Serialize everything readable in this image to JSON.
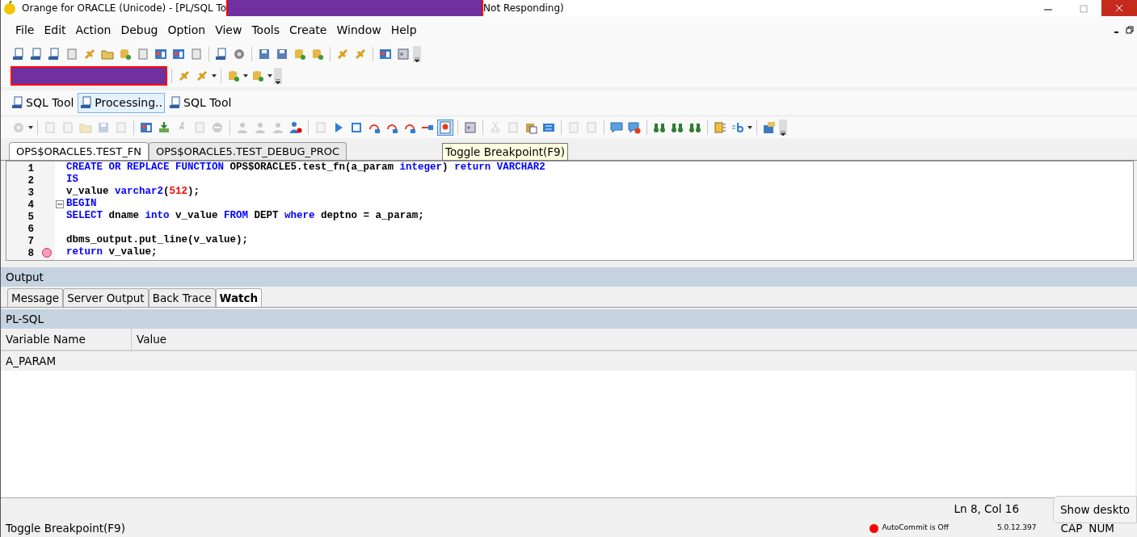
{
  "window": {
    "title_start": "Orange for ORACLE (Unicode) - [PL/SQL To",
    "title_end": "Not Responding)"
  },
  "menu": [
    "File",
    "Edit",
    "Action",
    "Debug",
    "Option",
    "View",
    "Tools",
    "Create",
    "Window",
    "Help"
  ],
  "tool_tabs": [
    {
      "label": "SQL Tool",
      "selected": false
    },
    {
      "label": "Processing..",
      "selected": true
    },
    {
      "label": "SQL Tool",
      "selected": false
    }
  ],
  "debug_toolbar": [
    {
      "kind": "gear",
      "disabled": true,
      "pressed": false
    },
    {
      "kind": "sep"
    },
    {
      "kind": "doc",
      "disabled": true,
      "pressed": false
    },
    {
      "kind": "doc",
      "disabled": true,
      "pressed": false
    },
    {
      "kind": "folder",
      "disabled": true,
      "pressed": false
    },
    {
      "kind": "save",
      "disabled": true,
      "pressed": false
    },
    {
      "kind": "doc",
      "disabled": true,
      "pressed": false
    },
    {
      "kind": "sep"
    },
    {
      "kind": "window",
      "disabled": false,
      "pressed": false
    },
    {
      "kind": "download",
      "disabled": false,
      "pressed": false
    },
    {
      "kind": "figure",
      "disabled": true,
      "pressed": false
    },
    {
      "kind": "doc",
      "disabled": true,
      "pressed": false
    },
    {
      "kind": "stopcircle",
      "disabled": true,
      "pressed": false
    },
    {
      "kind": "sep"
    },
    {
      "kind": "person",
      "disabled": true,
      "pressed": false
    },
    {
      "kind": "person",
      "disabled": true,
      "pressed": false
    },
    {
      "kind": "person",
      "disabled": true,
      "pressed": false
    },
    {
      "kind": "check",
      "disabled": false,
      "pressed": false
    },
    {
      "kind": "sep"
    },
    {
      "kind": "doc",
      "disabled": true,
      "pressed": false
    },
    {
      "kind": "play",
      "disabled": false,
      "pressed": false
    },
    {
      "kind": "stop",
      "disabled": false,
      "pressed": false
    },
    {
      "kind": "step",
      "disabled": false,
      "pressed": false
    },
    {
      "kind": "step",
      "disabled": false,
      "pressed": false
    },
    {
      "kind": "step",
      "disabled": false,
      "pressed": false
    },
    {
      "kind": "runto",
      "disabled": false,
      "pressed": false
    },
    {
      "kind": "breakpoint",
      "disabled": false,
      "pressed": true
    },
    {
      "kind": "sep"
    },
    {
      "kind": "list",
      "disabled": false,
      "pressed": false
    },
    {
      "kind": "sep"
    },
    {
      "kind": "scissors",
      "disabled": true,
      "pressed": false
    },
    {
      "kind": "doc",
      "disabled": true,
      "pressed": false
    },
    {
      "kind": "paste",
      "disabled": false,
      "pressed": false
    },
    {
      "kind": "all",
      "disabled": false,
      "pressed": false
    },
    {
      "kind": "sep"
    },
    {
      "kind": "doc",
      "disabled": true,
      "pressed": false
    },
    {
      "kind": "doc",
      "disabled": true,
      "pressed": false
    },
    {
      "kind": "sep"
    },
    {
      "kind": "chat",
      "disabled": false,
      "pressed": false
    },
    {
      "kind": "chatx",
      "disabled": false,
      "pressed": false
    },
    {
      "kind": "sep"
    },
    {
      "kind": "binoculars",
      "disabled": false,
      "pressed": false
    },
    {
      "kind": "binoculars",
      "disabled": false,
      "pressed": false
    },
    {
      "kind": "binoculars",
      "disabled": false,
      "pressed": false
    },
    {
      "kind": "sep"
    },
    {
      "kind": "panel",
      "disabled": false,
      "pressed": false
    },
    {
      "kind": "assign",
      "disabled": false,
      "pressed": false
    },
    {
      "kind": "sep"
    },
    {
      "kind": "props",
      "disabled": false,
      "pressed": false
    }
  ],
  "doc_tabs": [
    {
      "label": "OPS$ORACLE5.TEST_FN",
      "selected": true
    },
    {
      "label": "OPS$ORACLE5.TEST_DEBUG_PROC",
      "selected": false
    }
  ],
  "tooltip": "Toggle Breakpoint(F9)",
  "editor": {
    "lines": [
      {
        "number": "1",
        "breakpoint": false,
        "fold_start": false,
        "tokens": [
          {
            "kind": "kw",
            "text": "CREATE OR REPLACE FUNCTION"
          },
          {
            "kind": "plain",
            "text": " OPS$ORACLE5.test_fn(a_param "
          },
          {
            "kind": "kw",
            "text": "integer"
          },
          {
            "kind": "plain",
            "text": ") "
          },
          {
            "kind": "kw",
            "text": "return VARCHAR2"
          }
        ]
      },
      {
        "number": "2",
        "breakpoint": false,
        "fold_start": false,
        "tokens": [
          {
            "kind": "kw",
            "text": "IS"
          }
        ]
      },
      {
        "number": "3",
        "breakpoint": false,
        "fold_start": false,
        "tokens": [
          {
            "kind": "plain",
            "text": "v_value "
          },
          {
            "kind": "kw",
            "text": "varchar2"
          },
          {
            "kind": "plain",
            "text": "("
          },
          {
            "kind": "num",
            "text": "512"
          },
          {
            "kind": "plain",
            "text": ");"
          }
        ]
      },
      {
        "number": "4",
        "breakpoint": false,
        "fold_start": true,
        "tokens": [
          {
            "kind": "kw",
            "text": "BEGIN"
          }
        ]
      },
      {
        "number": "5",
        "breakpoint": false,
        "fold_start": false,
        "tokens": [
          {
            "kind": "kw",
            "text": "SELECT"
          },
          {
            "kind": "plain",
            "text": " dname "
          },
          {
            "kind": "kw",
            "text": "into"
          },
          {
            "kind": "plain",
            "text": " v_value "
          },
          {
            "kind": "kw",
            "text": "FROM"
          },
          {
            "kind": "plain",
            "text": " DEPT "
          },
          {
            "kind": "kw",
            "text": "where"
          },
          {
            "kind": "plain",
            "text": " deptno = a_param;"
          }
        ]
      },
      {
        "number": "6",
        "breakpoint": false,
        "fold_start": false
      },
      {
        "number": "7",
        "breakpoint": false,
        "fold_start": false,
        "tokens": [
          {
            "kind": "plain",
            "text": "dbms_output.put_line(v_value);"
          }
        ]
      },
      {
        "number": "8",
        "breakpoint": true,
        "fold_start": false,
        "tokens": [
          {
            "kind": "kw",
            "text": "return"
          },
          {
            "kind": "plain",
            "text": " v_value;"
          }
        ]
      }
    ]
  },
  "output": {
    "title": "Output",
    "tabs": [
      {
        "label": "Message",
        "selected": false
      },
      {
        "label": "Server Output",
        "selected": false
      },
      {
        "label": "Back Trace",
        "selected": false
      },
      {
        "label": "Watch",
        "selected": true
      }
    ],
    "section": "PL-SQL",
    "columns": [
      "Variable Name",
      "Value"
    ],
    "rows": [
      [
        "A_PARAM"
      ]
    ]
  },
  "status_bar": {
    "position": "Ln 8, Col 16",
    "message": "Toggle Breakpoint(F9)",
    "autocommit": "AutoCommit is Off",
    "version": "5.0.12.397",
    "keys": [
      "CAP",
      "NUM"
    ]
  },
  "desktop_tooltip": "Show deskto"
}
